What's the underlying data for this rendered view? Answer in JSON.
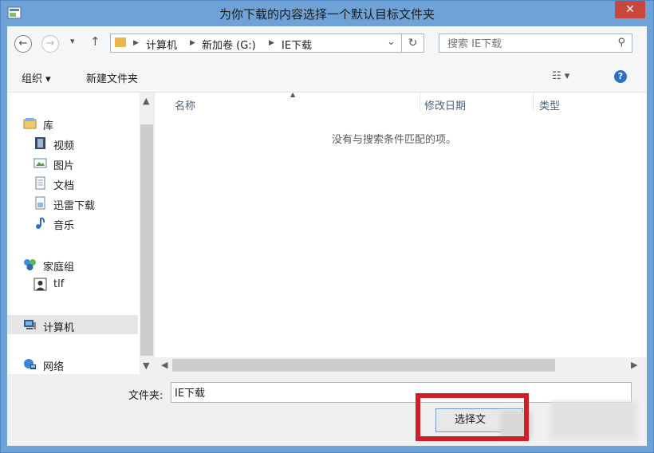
{
  "window": {
    "title": "为你下载的内容选择一个默认目标文件夹",
    "close_glyph": "✕"
  },
  "address_bar": {
    "back_glyph": "←",
    "forward_glyph": "→",
    "recent_glyph": "▾",
    "up_glyph": "↑",
    "breadcrumb": [
      "计算机",
      "新加卷 (G:)",
      "IE下载"
    ],
    "dropdown_glyph": "⌄",
    "refresh_glyph": "↻"
  },
  "search": {
    "placeholder": "搜索 IE下载",
    "icon": "search-icon"
  },
  "toolbar": {
    "organize_label": "组织 ▾",
    "new_folder_label": "新建文件夹",
    "view_glyph": "☷ ▾",
    "help_glyph": "?"
  },
  "nav_pane": {
    "items": [
      {
        "label": "库",
        "icon": "library-icon"
      },
      {
        "label": "视频",
        "icon": "video-icon"
      },
      {
        "label": "图片",
        "icon": "picture-icon"
      },
      {
        "label": "文档",
        "icon": "document-icon"
      },
      {
        "label": "迅雷下载",
        "icon": "download-folder-icon"
      },
      {
        "label": "音乐",
        "icon": "music-icon"
      },
      {
        "label": "家庭组",
        "icon": "homegroup-icon"
      },
      {
        "label": "tlf",
        "icon": "user-icon"
      },
      {
        "label": "计算机",
        "icon": "computer-icon",
        "selected": true
      },
      {
        "label": "网络",
        "icon": "network-icon"
      }
    ]
  },
  "file_list": {
    "columns": [
      "名称",
      "修改日期",
      "类型"
    ],
    "empty_message": "没有与搜索条件匹配的项。"
  },
  "footer": {
    "folder_label": "文件夹:",
    "folder_value": "IE下载",
    "select_button": "选择文"
  },
  "colors": {
    "title_bar": "#6fa3d8",
    "close_button": "#c9463d",
    "highlight_box": "#d11f29"
  }
}
